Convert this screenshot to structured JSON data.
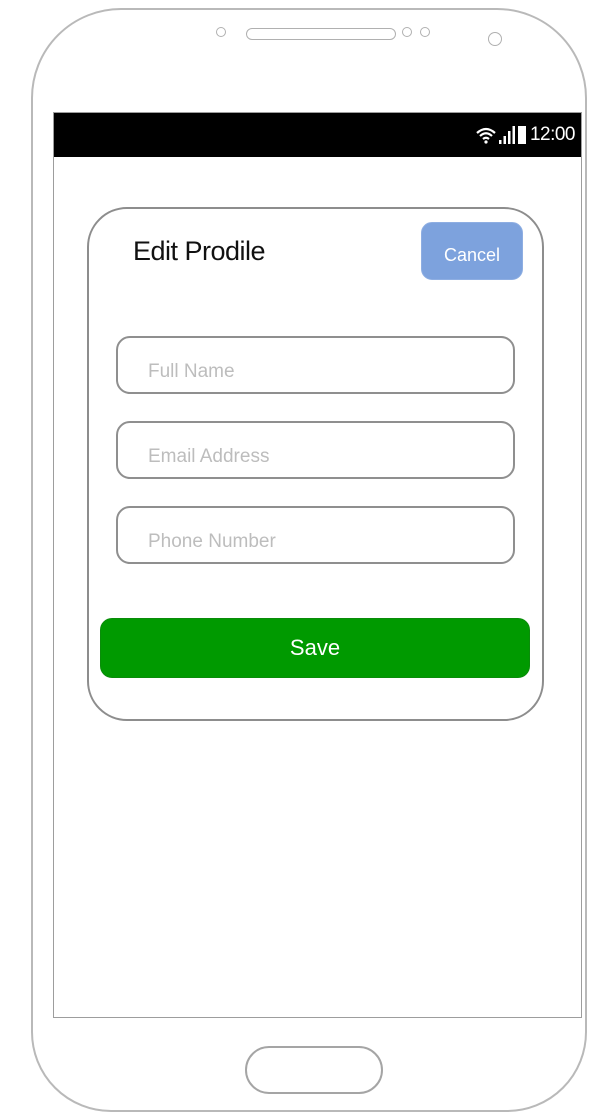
{
  "status_bar": {
    "time": "12:00",
    "icons": [
      "wifi-icon",
      "signal-icon",
      "battery-icon"
    ]
  },
  "form": {
    "title": "Edit Prodile",
    "cancel_label": "Cancel",
    "fields": [
      {
        "placeholder": "Full Name",
        "value": ""
      },
      {
        "placeholder": "Email Address",
        "value": ""
      },
      {
        "placeholder": "Phone Number",
        "value": ""
      }
    ],
    "save_label": "Save"
  },
  "colors": {
    "status_bar": "#000000",
    "cancel_button": "#7da2dd",
    "save_button": "#009a00"
  }
}
